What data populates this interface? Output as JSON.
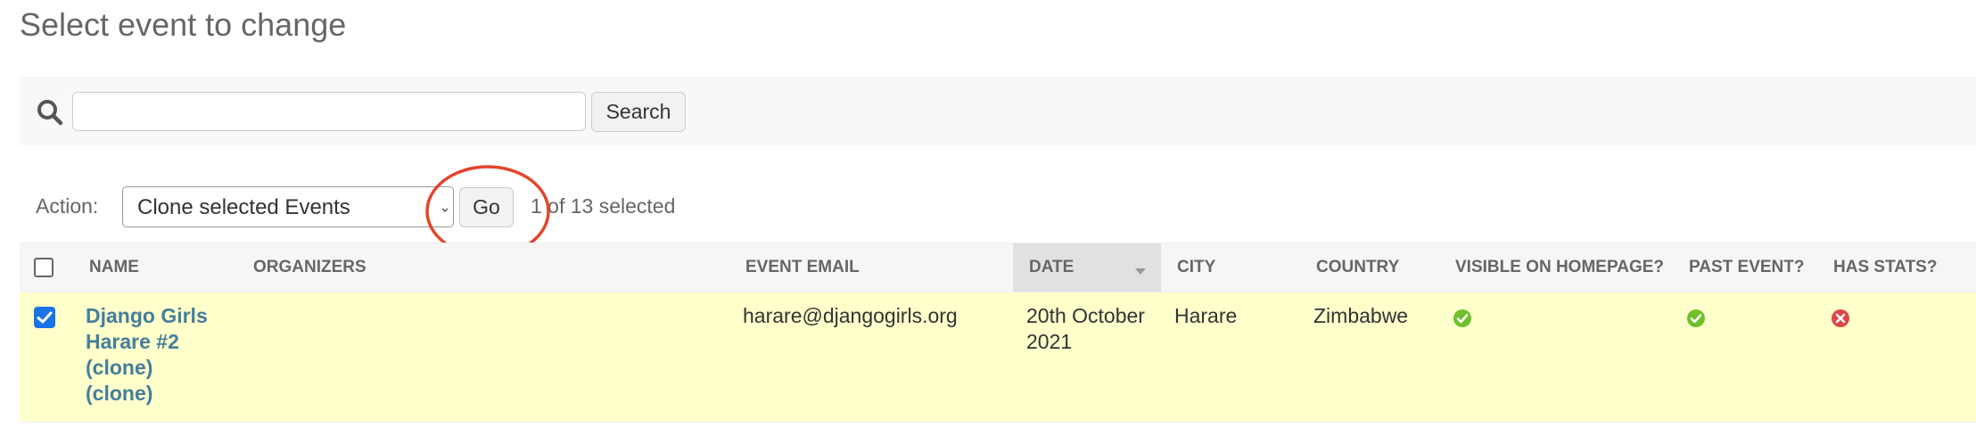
{
  "page": {
    "title": "Select event to change"
  },
  "search": {
    "value": "",
    "placeholder": "",
    "button_label": "Search"
  },
  "actions": {
    "label": "Action:",
    "selected": "Clone selected Events",
    "go_label": "Go",
    "counter": "1 of 13 selected"
  },
  "table": {
    "headers": {
      "name": "NAME",
      "organizers": "ORGANIZERS",
      "event_email": "EVENT EMAIL",
      "date": "DATE",
      "city": "CITY",
      "country": "COUNTRY",
      "visible_on_homepage": "VISIBLE ON HOMEPAGE?",
      "past_event": "PAST EVENT?",
      "has_stats": "HAS STATS?"
    },
    "sorted_column": "DATE",
    "rows": [
      {
        "checked": true,
        "name": "Django Girls Harare #2 (clone) (clone)",
        "organizers": "",
        "event_email": "harare@djangogirls.org",
        "date": "20th October 2021",
        "city": "Harare",
        "country": "Zimbabwe",
        "visible_on_homepage": "yes-icon",
        "past_event": "yes-icon",
        "has_stats": "no-icon"
      }
    ]
  },
  "colors": {
    "link": "#447e9b",
    "selected_row": "#ffffcc",
    "yes_icon": "#70bf2b",
    "no_icon": "#dd4646",
    "annotation": "#e2452b",
    "checkbox": "#1a73e8"
  }
}
